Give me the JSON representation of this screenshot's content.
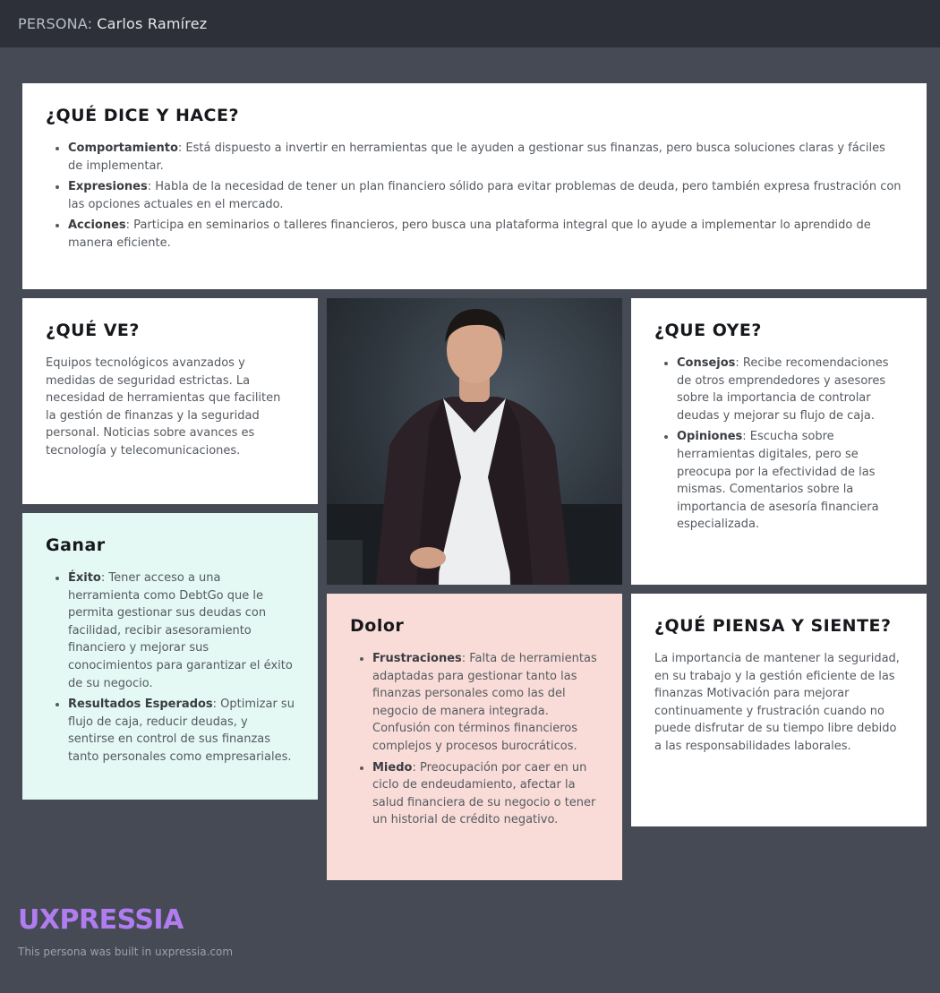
{
  "header": {
    "label": "PERSONA:",
    "name": "Carlos Ramírez"
  },
  "says_does": {
    "title": "¿QUÉ DICE Y HACE?",
    "items": [
      {
        "key": "Comportamiento",
        "text": ": Está dispuesto a invertir en herramientas que le ayuden a gestionar sus finanzas, pero busca soluciones claras y fáciles de implementar."
      },
      {
        "key": "Expresiones",
        "text": ": Habla de la necesidad de tener un plan financiero sólido para evitar problemas de deuda, pero también expresa frustración con las opciones actuales en el mercado."
      },
      {
        "key": "Acciones",
        "text": ": Participa en seminarios o talleres financieros, pero busca una plataforma integral que lo ayude a implementar lo aprendido de manera eficiente."
      }
    ]
  },
  "sees": {
    "title": "¿QUÉ VE?",
    "text": "Equipos tecnológicos avanzados y medidas de seguridad estrictas. La necesidad de herramientas que faciliten la gestión de finanzas y la seguridad personal. Noticias sobre avances es tecnología y telecomunicaciones."
  },
  "hears": {
    "title": "¿QUE OYE?",
    "items": [
      {
        "key": "Consejos",
        "text": ": Recibe recomendaciones de otros emprendedores y asesores sobre la importancia de controlar deudas y mejorar su flujo de caja."
      },
      {
        "key": "Opiniones",
        "text": ": Escucha sobre herramientas digitales, pero se preocupa por la efectividad de las mismas. Comentarios sobre la importancia de asesoría financiera especializada."
      }
    ]
  },
  "gains": {
    "title": "Ganar",
    "items": [
      {
        "key": "Éxito",
        "text": ": Tener acceso a una herramienta como DebtGo que le permita gestionar sus deudas con facilidad, recibir asesoramiento financiero y mejorar sus conocimientos para garantizar el éxito de su negocio."
      },
      {
        "key": "Resultados Esperados",
        "text": ": Optimizar su flujo de caja, reducir deudas, y sentirse en control de sus finanzas tanto personales como empresariales."
      }
    ]
  },
  "pains": {
    "title": "Dolor",
    "items": [
      {
        "key": "Frustraciones",
        "text": ": Falta de herramientas adaptadas para gestionar tanto las finanzas personales como las del negocio de manera integrada. Confusión con términos financieros complejos y procesos burocráticos."
      },
      {
        "key": "Miedo",
        "text": ": Preocupación por caer en un ciclo de endeudamiento, afectar la salud financiera de su negocio o tener un historial de crédito negativo."
      }
    ]
  },
  "thinks_feels": {
    "title": "¿QUÉ PIENSA Y SIENTE?",
    "text": "La importancia de mantener la seguridad, en su trabajo y la gestión eficiente de las finanzas Motivación para mejorar continuamente y frustración cuando no puede disfrutar de su tiempo libre debido a las responsabilidades laborales."
  },
  "footer": {
    "logo": "UXPRESSIA",
    "note": "This persona was built in uxpressia.com"
  },
  "colors": {
    "background": "#454a54",
    "header": "#2d3038",
    "gains_card": "#e4f8f4",
    "pains_card": "#f9dcd8",
    "logo": "#b07cf0"
  },
  "icons": {
    "photo": "persona-photo"
  }
}
